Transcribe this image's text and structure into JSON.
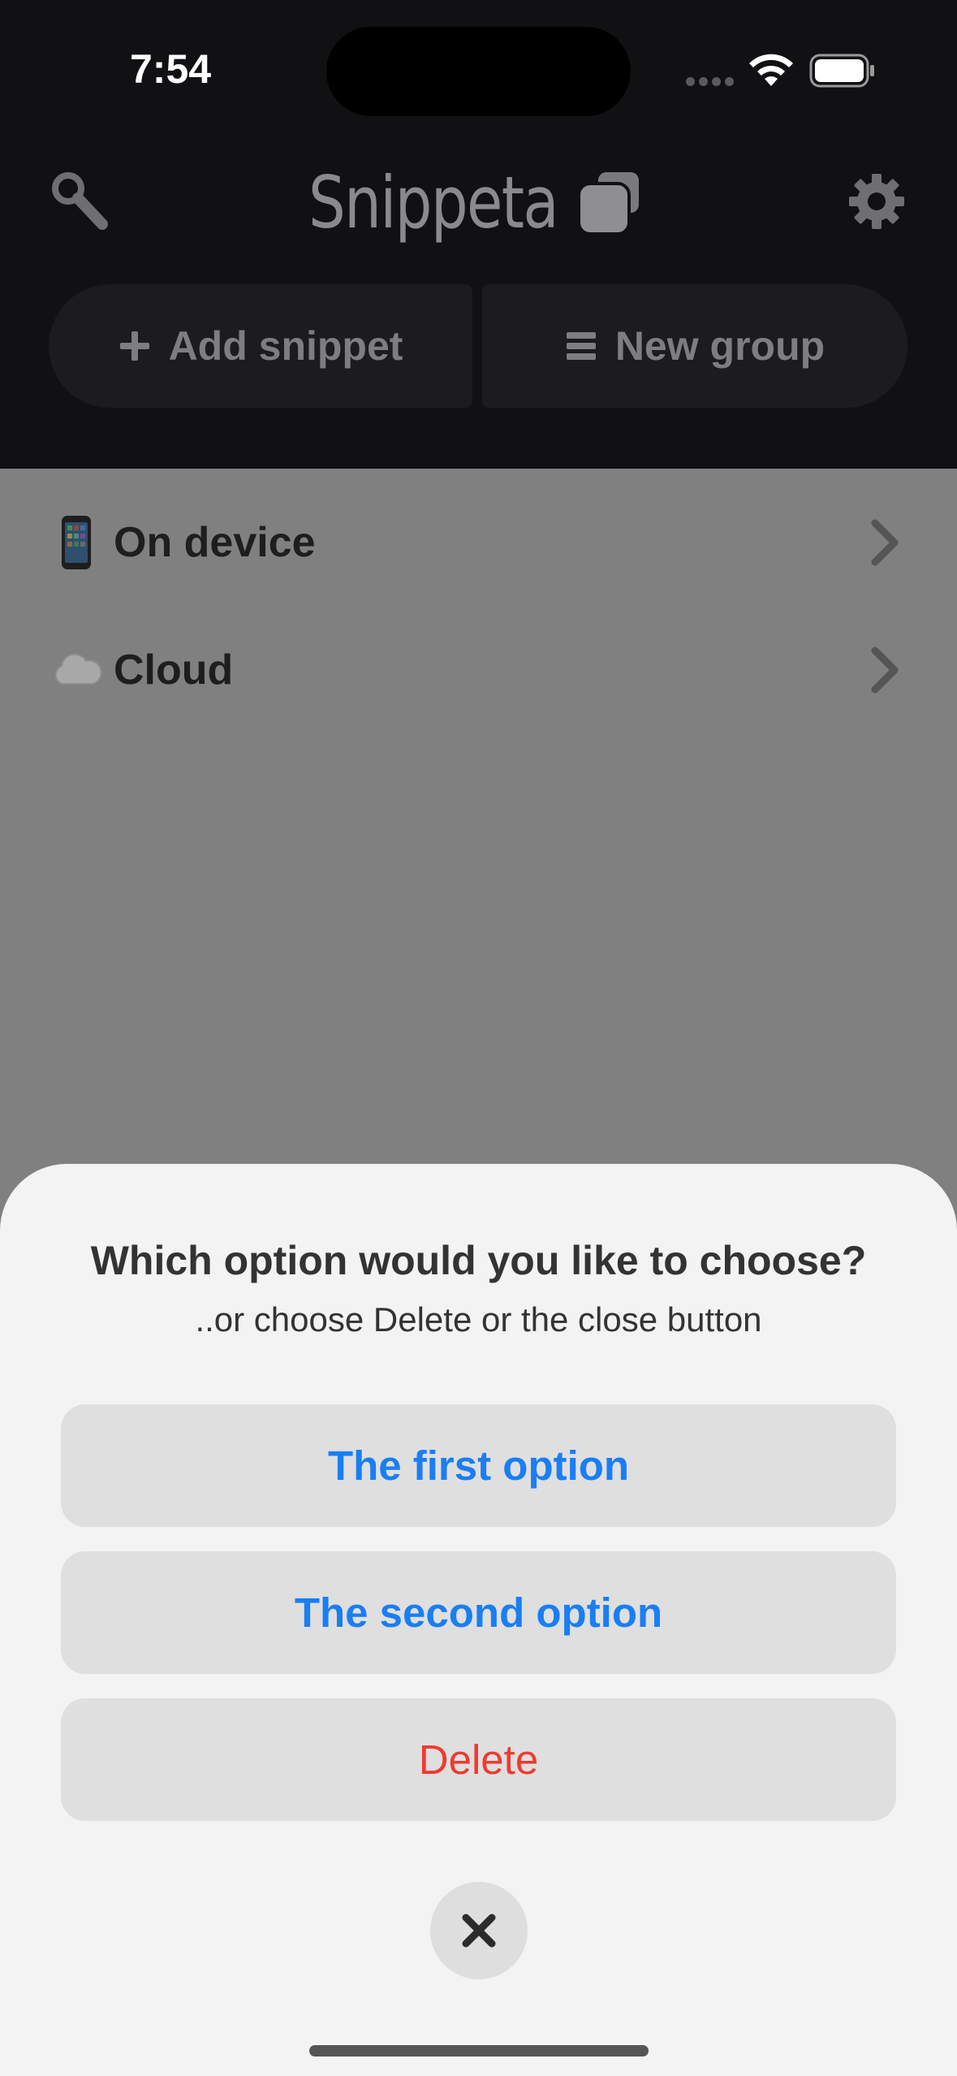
{
  "status_bar": {
    "time": "7:54"
  },
  "header": {
    "app_title": "Snippeta",
    "icons": [
      "search-icon",
      "gear-icon",
      "logo-squares"
    ],
    "add_snippet_label": "Add snippet",
    "new_group_label": "New group"
  },
  "list": {
    "items": [
      {
        "label": "On device",
        "icon": "mobile-phone-emoji"
      },
      {
        "label": "Cloud",
        "icon": "cloud-emoji"
      }
    ]
  },
  "sheet": {
    "title": "Which option would you like to choose?",
    "subtitle": "..or choose Delete or the close button",
    "options": [
      "The first option",
      "The second option"
    ],
    "delete_label": "Delete",
    "colors": {
      "option_text": "#1a7ef3",
      "delete_text": "#f03a30"
    }
  }
}
